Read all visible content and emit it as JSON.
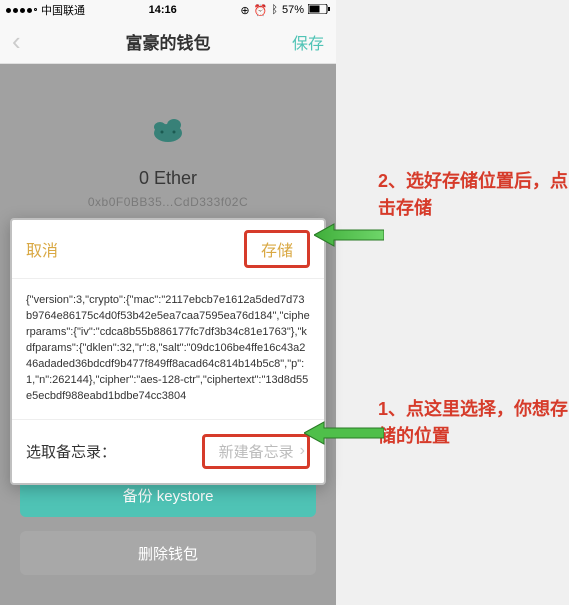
{
  "status": {
    "carrier": "中国联通",
    "time": "14:16",
    "battery": "57%"
  },
  "nav": {
    "title": "富豪的钱包",
    "save": "保存"
  },
  "wallet": {
    "balance": "0 Ether",
    "address": "0xb0F0BB35...CdD333f02C"
  },
  "modal": {
    "cancel": "取消",
    "store": "存储",
    "body": "{\"version\":3,\"crypto\":{\"mac\":\"2117ebcb7e1612a5ded7d73b9764e86175c4d0f53b42e5ea7caa7595ea76d184\",\"cipherparams\":{\"iv\":\"cdca8b55b886177fc7df3b34c81e1763\"},\"kdfparams\":{\"dklen\":32,\"r\":8,\"salt\":\"09dc106be4ffe16c43a246adaded36bdcdf9b477f849ff8acad64c814b14b5c8\",\"p\":1,\"n\":262144},\"cipher\":\"aes-128-ctr\",\"ciphertext\":\"13d8d55e5ecbdf988eabd1bdbe74cc3804",
    "foot_label": "选取备忘录：",
    "memo_btn": "新建备忘录"
  },
  "buttons": {
    "backup": "备份 keystore",
    "delete": "删除钱包"
  },
  "annotations": {
    "a1": "2、选好存储位置后，点击存储",
    "a2": "1、点这里选择，你想存储的位置"
  }
}
